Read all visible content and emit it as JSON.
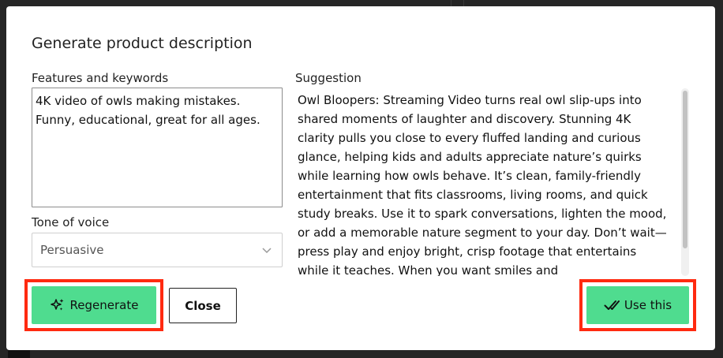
{
  "dialog": {
    "title": "Generate product description",
    "features": {
      "label": "Features and keywords",
      "value": "4K video of owls making mistakes.\nFunny, educational, great for all ages."
    },
    "tone": {
      "label": "Tone of voice",
      "selected": "Persuasive"
    },
    "suggestion": {
      "label": "Suggestion",
      "text": "Owl Bloopers: Streaming Video turns real owl slip-ups into shared moments of laughter and discovery. Stunning 4K clarity pulls you close to every fluffed landing and curious glance, helping kids and adults appreciate nature’s quirks while learning how owls behave. It’s clean, family-friendly entertainment that fits classrooms, living rooms, and quick study breaks. Use it to spark conversations, lighten the mood, or add a memorable nature segment to your day. Don’t wait—press play and enjoy bright, crisp footage that entertains while it teaches. When you want smiles and"
    },
    "buttons": {
      "regenerate": "Regenerate",
      "close": "Close",
      "use_this": "Use this"
    }
  },
  "colors": {
    "primary_button": "#4fdc8f",
    "highlight": "#ff2a10"
  },
  "icons": {
    "regenerate": "sparkles-icon",
    "use_this": "double-check-icon",
    "tone_select": "chevron-down-icon"
  }
}
